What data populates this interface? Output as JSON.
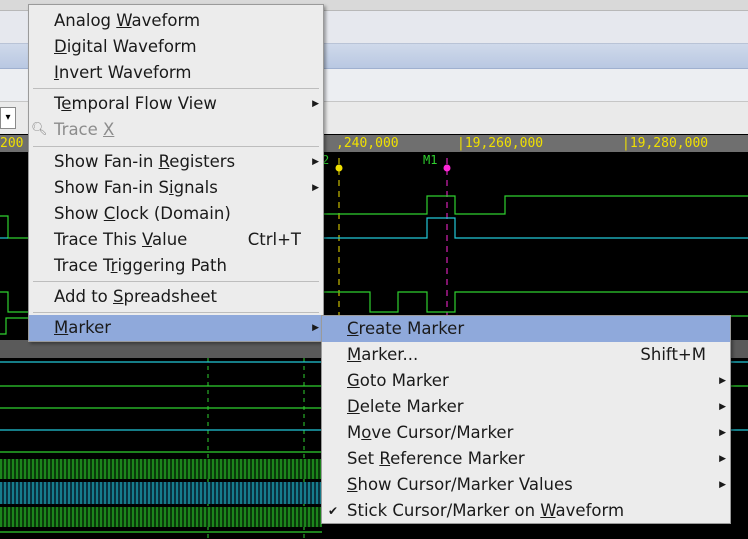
{
  "ruler": {
    "ticks": [
      "200",
      ",240,000",
      "|19,260,000",
      "|19,280,000"
    ]
  },
  "markers": {
    "m1_label": "M1",
    "cursor_label": "2"
  },
  "context_menu": {
    "items": [
      {
        "pre": "Analog ",
        "ul": "W",
        "post": "aveform"
      },
      {
        "pre": "",
        "ul": "D",
        "post": "igital Waveform"
      },
      {
        "pre": "",
        "ul": "I",
        "post": "nvert Waveform"
      },
      {
        "pre": "T",
        "ul": "e",
        "post": "mporal Flow View"
      },
      {
        "pre": "Trace ",
        "ul": "X",
        "post": ""
      },
      {
        "pre": "Show Fan-in ",
        "ul": "R",
        "post": "egisters"
      },
      {
        "pre": "Show Fan-in S",
        "ul": "i",
        "post": "gnals"
      },
      {
        "pre": "Show ",
        "ul": "C",
        "post": "lock (Domain)"
      },
      {
        "pre": "Trace This ",
        "ul": "V",
        "post": "alue"
      },
      {
        "pre": "Trace T",
        "ul": "r",
        "post": "iggering Path"
      },
      {
        "pre": "Add to ",
        "ul": "S",
        "post": "preadsheet"
      },
      {
        "pre": "",
        "ul": "M",
        "post": "arker"
      }
    ],
    "trace_value_shortcut": "Ctrl+T"
  },
  "marker_submenu": {
    "items": [
      {
        "pre": "",
        "ul": "C",
        "post": "reate Marker"
      },
      {
        "pre": "",
        "ul": "M",
        "post": "arker..."
      },
      {
        "pre": "",
        "ul": "G",
        "post": "oto Marker"
      },
      {
        "pre": "",
        "ul": "D",
        "post": "elete Marker"
      },
      {
        "pre": "M",
        "ul": "o",
        "post": "ve Cursor/Marker"
      },
      {
        "pre": "Set ",
        "ul": "R",
        "post": "eference Marker"
      },
      {
        "pre": "",
        "ul": "S",
        "post": "how Cursor/Marker Values"
      },
      {
        "pre": "Stick Cursor/Marker on ",
        "ul": "W",
        "post": "aveform"
      }
    ],
    "marker_shortcut": "Shift+M",
    "stick_checked": "✔"
  },
  "colors": {
    "menu_highlight": "#8fa9db",
    "ruler_text": "#f0e000",
    "wave_green": "#2fd02f",
    "wave_cyan": "#22c8d8",
    "marker_magenta": "#ff28d8",
    "cursor_yellow": "#f0e000"
  }
}
